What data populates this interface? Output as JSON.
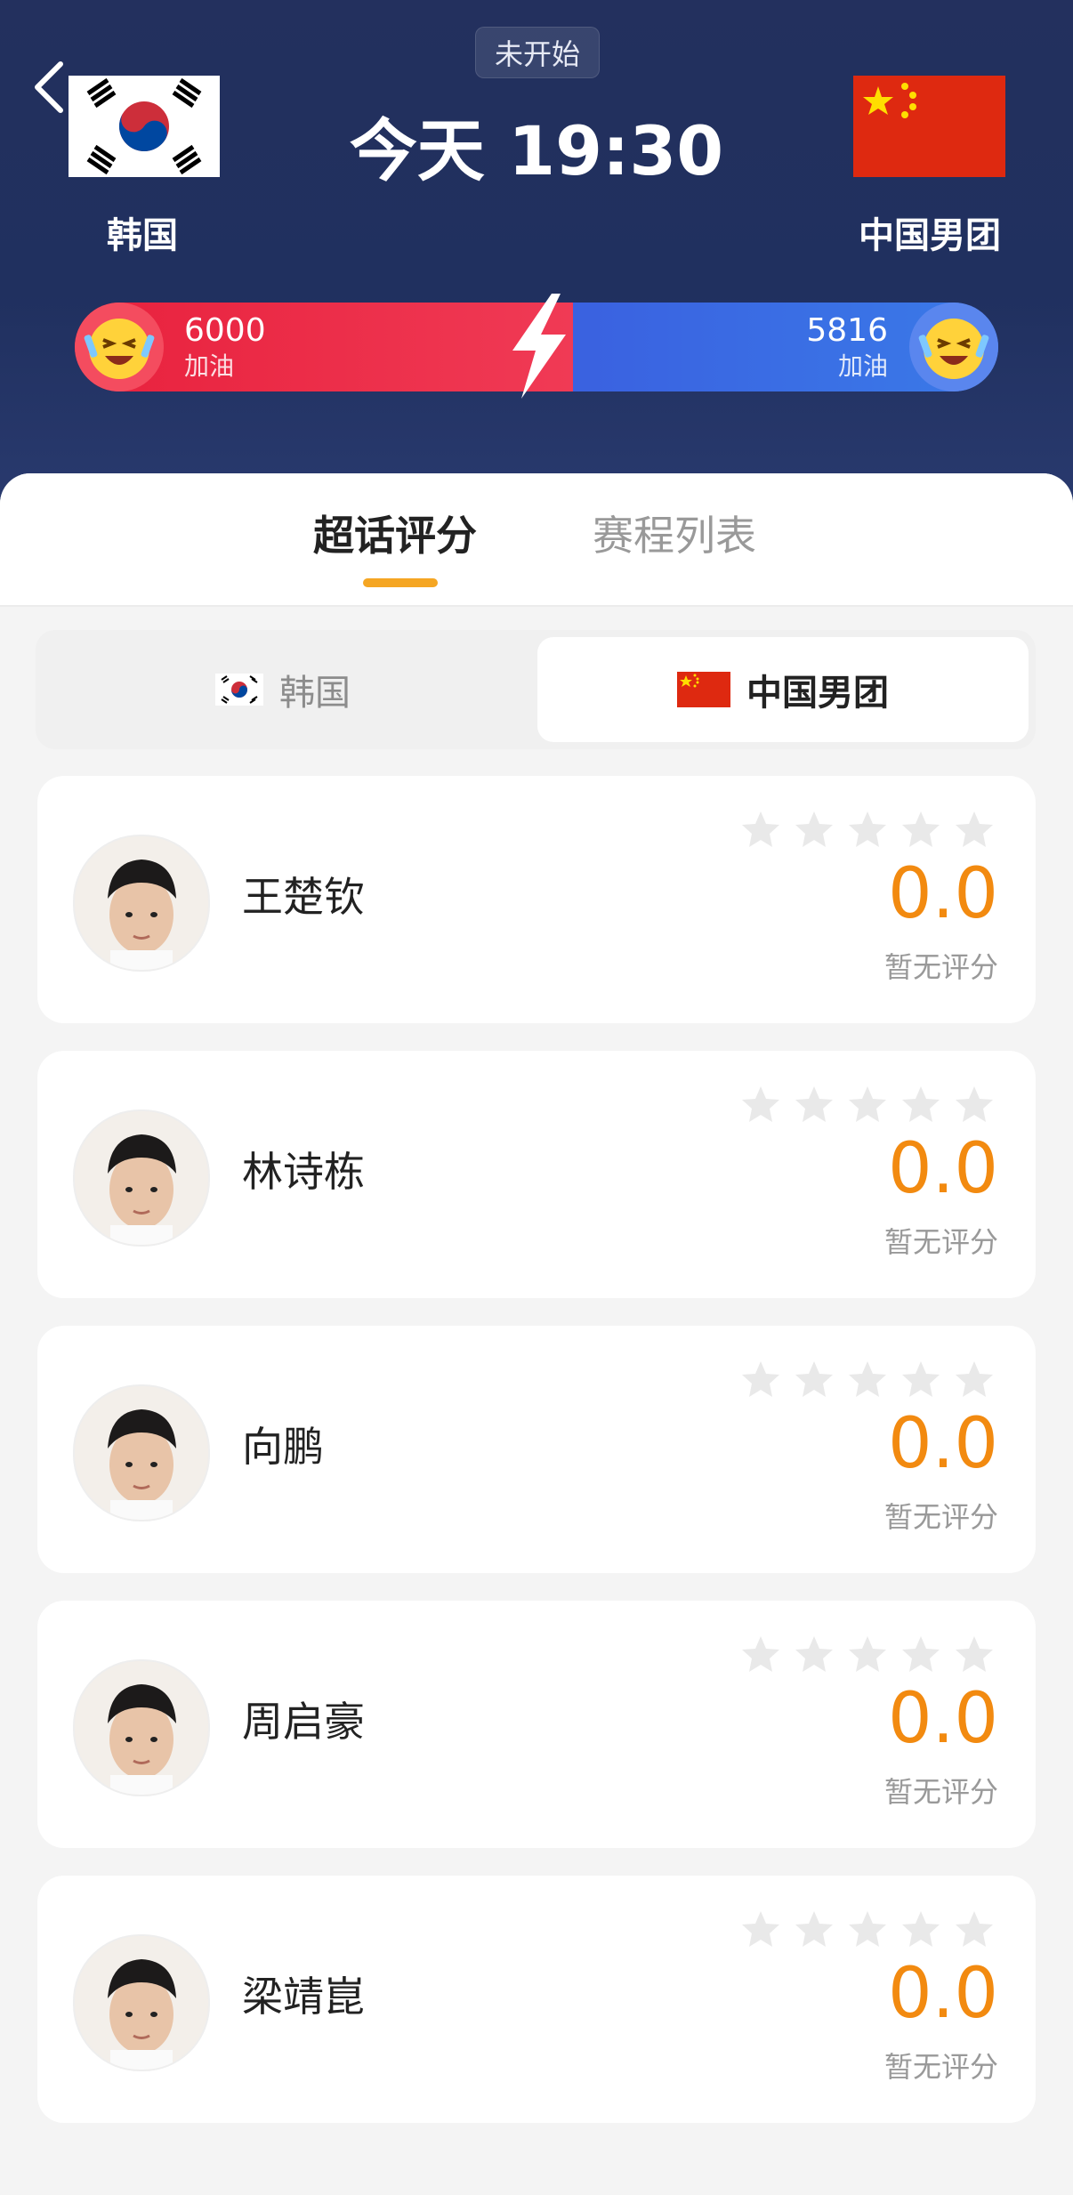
{
  "match": {
    "status": "未开始",
    "time": "今天 19:30",
    "home_team": "韩国",
    "away_team": "中国男团"
  },
  "cheer": {
    "home_count": "6000",
    "home_label": "加油",
    "away_count": "5816",
    "away_label": "加油"
  },
  "tabs": [
    "超话评分",
    "赛程列表"
  ],
  "segment": {
    "option_korea": "韩国",
    "option_china": "中国男团",
    "selected": "中国男团"
  },
  "players": [
    {
      "name": "王楚钦",
      "score": "0.0",
      "rating_note": "暂无评分",
      "stars": 0
    },
    {
      "name": "林诗栋",
      "score": "0.0",
      "rating_note": "暂无评分",
      "stars": 0
    },
    {
      "name": "向鹏",
      "score": "0.0",
      "rating_note": "暂无评分",
      "stars": 0
    },
    {
      "name": "周启豪",
      "score": "0.0",
      "rating_note": "暂无评分",
      "stars": 0
    },
    {
      "name": "梁靖崑",
      "score": "0.0",
      "rating_note": "暂无评分",
      "stars": 0
    }
  ],
  "colors": {
    "accent": "#f5a623",
    "score": "#f28a10",
    "home": "#e8213d",
    "away": "#3a6ee5"
  }
}
